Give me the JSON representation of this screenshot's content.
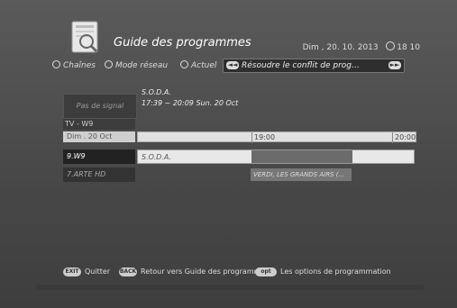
{
  "header": {
    "title": "Guide des programmes",
    "date": "Dim , 20. 10. 2013",
    "time": "18 10"
  },
  "menu": {
    "options": [
      "Chaînes",
      "Mode réseau",
      "Actuel"
    ],
    "conflict_label": "Résoudre le conflit de prog…",
    "arrow_left": "◄◄",
    "arrow_right": "►►"
  },
  "preview": {
    "signal": "Pas de signal",
    "program_title": "S.O.D.A.",
    "program_time": "17:39 ~ 20:09  Sun. 20 Oct"
  },
  "grid": {
    "channel_group": "TV - W9",
    "date": "Dim . 20 Oct",
    "times": [
      "19:00",
      "20:00"
    ],
    "channels": [
      {
        "name": "9.W9",
        "program": "S.O.D.A."
      },
      {
        "name": "7.ARTE HD",
        "program": "VERDI, LES GRANDS AIRS (..."
      }
    ]
  },
  "footer": {
    "exit_btn": "EXIT",
    "exit_label": "Quitter",
    "back_btn": "BACK",
    "back_label": "Retour vers Guide des programmes",
    "opt_btn": "opt",
    "opt_label": "Les options de programmation"
  }
}
